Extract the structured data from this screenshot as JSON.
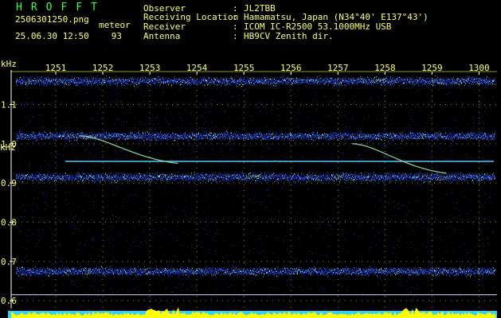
{
  "brand": "HROFFT",
  "file_name": "2506301250.png",
  "timestamp": "25.06.30 12:50",
  "meteor": {
    "label": "meteor",
    "count": "93"
  },
  "info": [
    {
      "key": "Observer",
      "value": "JL2TBB"
    },
    {
      "key": "Receiving Location",
      "value": "Hamamatsu, Japan (N34°40' E137°43')"
    },
    {
      "key": "Receiver",
      "value": "ICOM IC-R2500 53.1000MHz USB"
    },
    {
      "key": "Antenna",
      "value": "HB9CV Zenith dir."
    }
  ],
  "separator": ":",
  "colors": {
    "text": "#ffff66",
    "brand": "#33ff55",
    "grid": "#ffff44",
    "noise": "#1530c8",
    "carrier": "#55c8ff",
    "level": "#ffff00"
  },
  "chart_data": {
    "type": "heatmap",
    "x_unit": "",
    "y_unit": "kHz",
    "x_ticks": [
      "1251",
      "1252",
      "1253",
      "1254",
      "1255",
      "1256",
      "1257",
      "1258",
      "1259",
      "1300"
    ],
    "y_ticks": [
      "1.1",
      "1.0",
      "0.9",
      "0.8",
      "0.7",
      "0.6"
    ],
    "x_range": [
      1250.5,
      1300.1
    ],
    "y_range": [
      0.58,
      1.18
    ],
    "noise_bands_khz": [
      1.16,
      1.02,
      0.915,
      0.675
    ],
    "carrier_khz": 0.955,
    "carrier_start": 1251.2,
    "reference_line_khz": 0.615,
    "meteor_echoes": [
      {
        "start": 1251.5,
        "end": 1253.6,
        "f_start_khz": 1.02,
        "f_end_khz": 0.95
      },
      {
        "start": 1257.3,
        "end": 1259.3,
        "f_start_khz": 1.0,
        "f_end_khz": 0.925
      }
    ]
  }
}
